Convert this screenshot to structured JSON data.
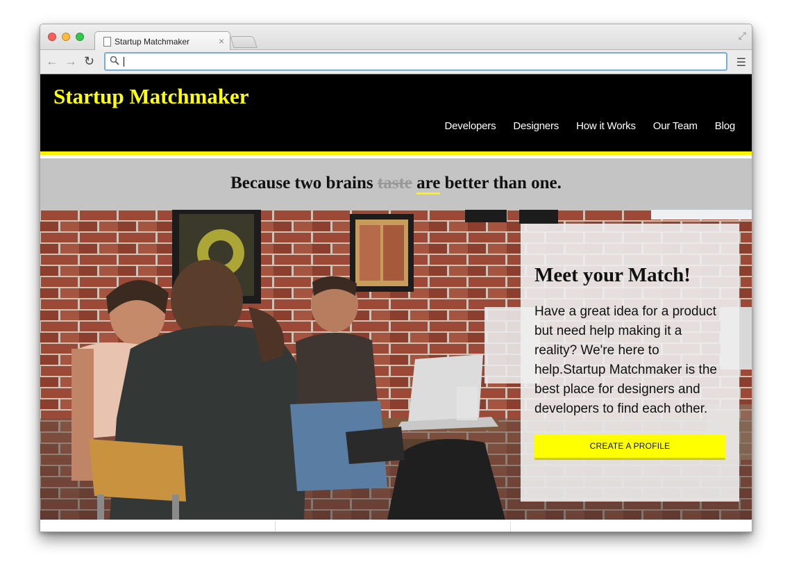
{
  "browser": {
    "tab_title": "Startup Matchmaker",
    "tab_close": "×",
    "address_value": "",
    "colors": {
      "close": "#fc605b",
      "minimize": "#fdbc40",
      "zoom": "#34c84a"
    }
  },
  "site": {
    "brand": "Startup Matchmaker",
    "nav": [
      "Developers",
      "Designers",
      "How it Works",
      "Our Team",
      "Blog"
    ],
    "tagline": {
      "before": "Because two brains ",
      "struck": "taste",
      "underlined": "are",
      "after": " better than one."
    },
    "hero": {
      "heading": "Meet your Match!",
      "body": "Have a great idea for a product but need help making it a reality? We're here to help.Startup Matchmaker is the best place for designers and developers to find each other.",
      "cta": "CREATE A PROFILE"
    },
    "colors": {
      "accent": "#ffff00",
      "header_bg": "#000000",
      "tagline_bg": "#c4c4c4"
    }
  }
}
